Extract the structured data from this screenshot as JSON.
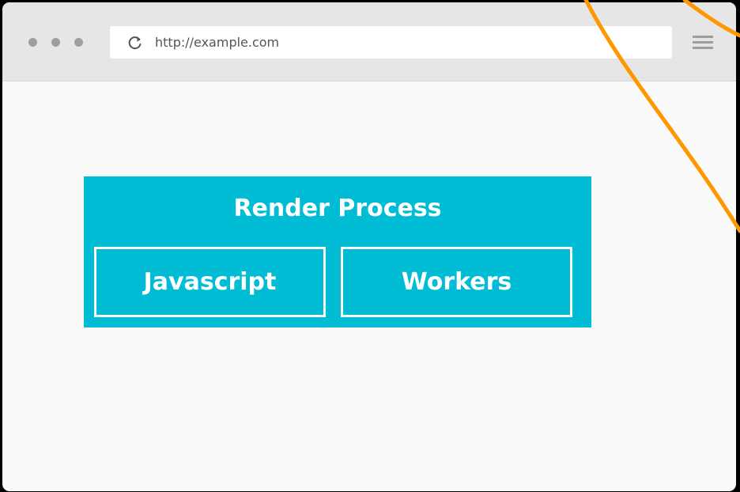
{
  "browser": {
    "url": "http://example.com",
    "icons": {
      "reload": "reload-icon",
      "menu": "hamburger-menu-icon",
      "window_controls": "window-control-dots"
    }
  },
  "diagram": {
    "process_title": "Render Process",
    "components": [
      "Javascript",
      "Workers"
    ]
  },
  "colors": {
    "process_box": "#00bcd4",
    "component_border": "#ffffff",
    "connector_curve": "#ff9800",
    "toolbar": "#e6e6e6",
    "page_background": "#fafafa"
  }
}
